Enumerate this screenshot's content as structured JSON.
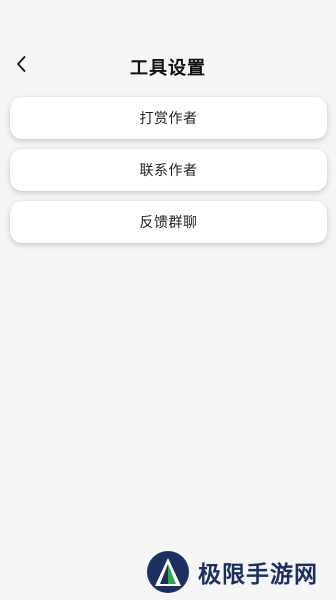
{
  "header": {
    "back_icon": "chevron-left-icon",
    "title": "工具设置"
  },
  "menu": {
    "items": [
      {
        "label": "打赏作者"
      },
      {
        "label": "联系作者"
      },
      {
        "label": "反馈群聊"
      }
    ]
  },
  "watermark": {
    "text": "极限手游网",
    "logo_icon": "triangle-logo-icon",
    "colors": {
      "navy": "#1d2f5e",
      "green": "#2ea84b"
    }
  }
}
